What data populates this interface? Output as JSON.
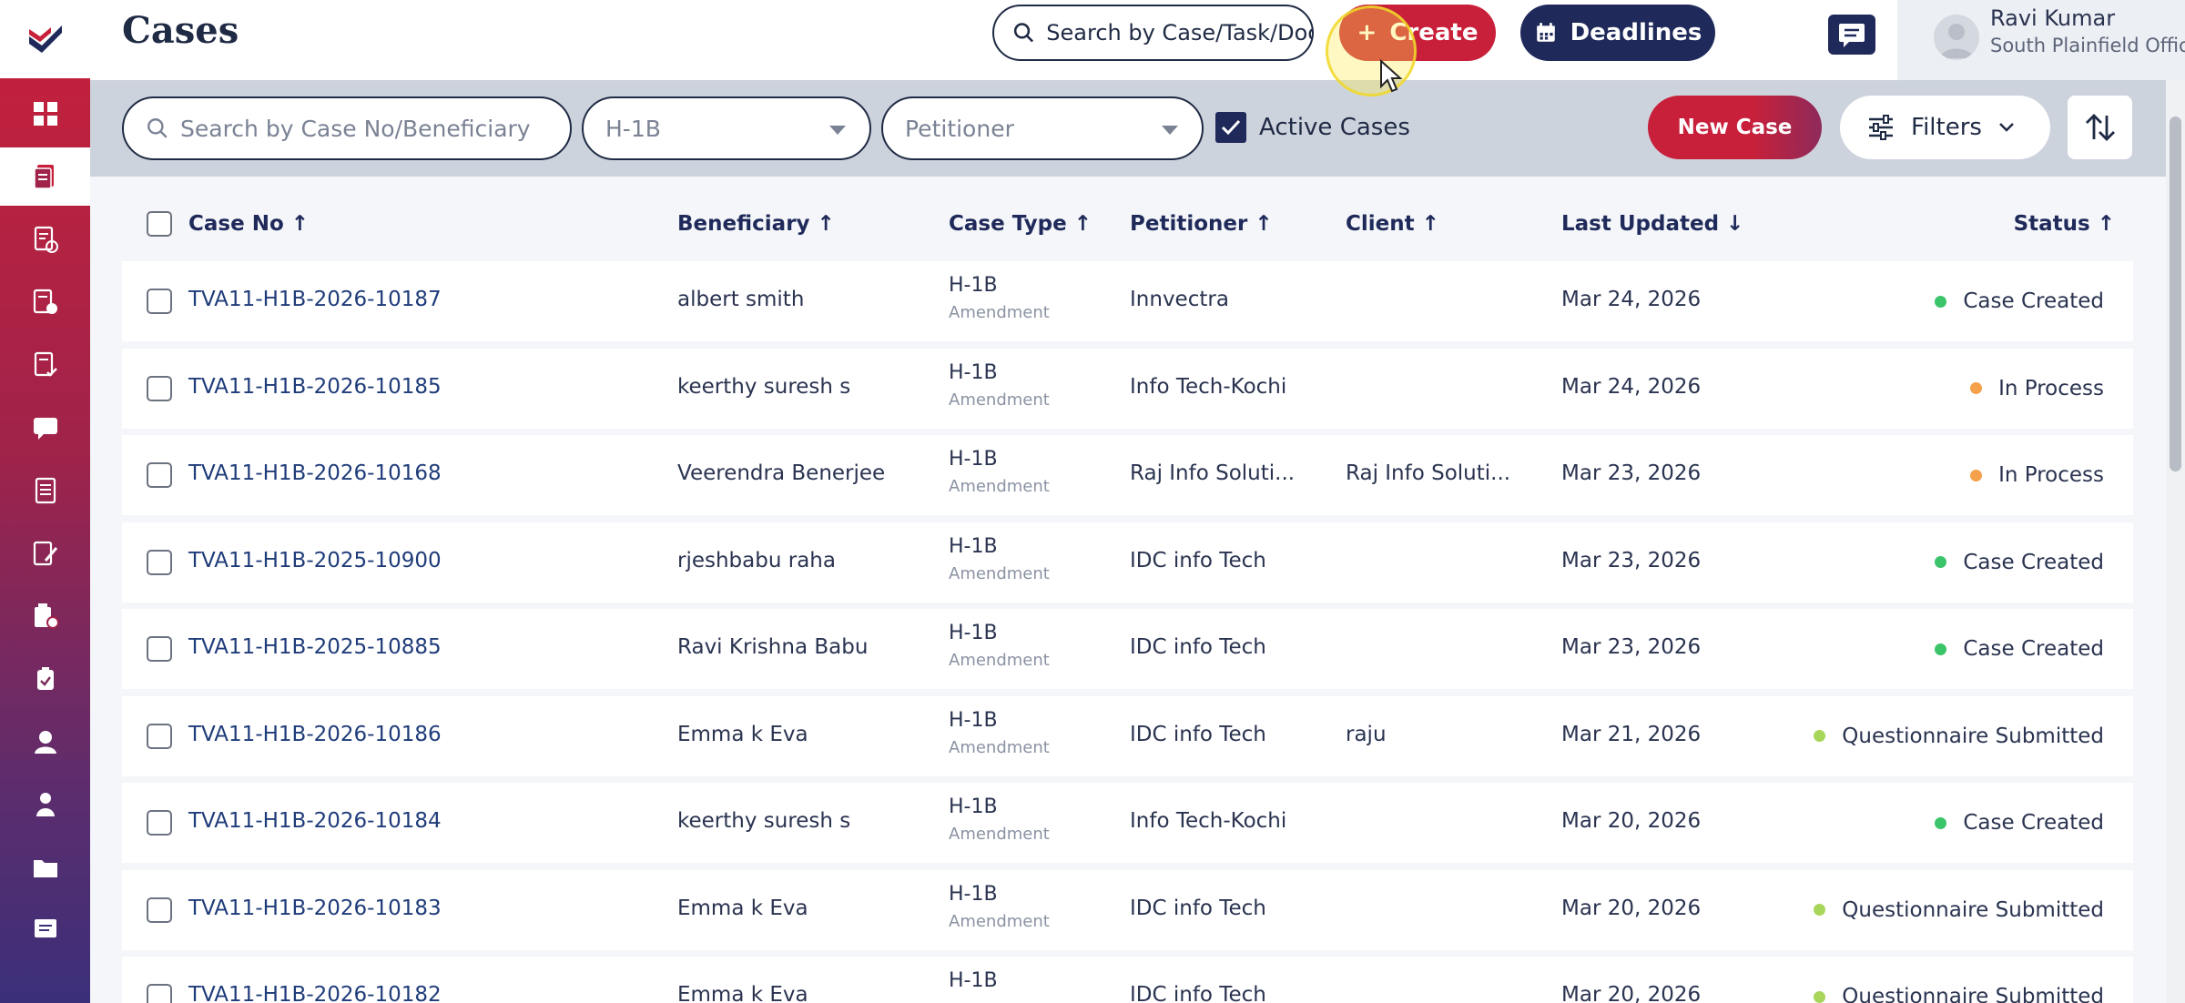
{
  "header": {
    "title": "Cases",
    "global_search_placeholder": "Search by Case/Task/Docu",
    "create_label": "Create",
    "deadlines_label": "Deadlines",
    "user": {
      "name": "Ravi Kumar",
      "office": "South Plainfield Office"
    }
  },
  "toolbar": {
    "search_placeholder": "Search by Case No/Beneficiary",
    "case_type_value": "H-1B",
    "petitioner_placeholder": "Petitioner",
    "active_cases_label": "Active Cases",
    "active_cases_checked": true,
    "new_case_label": "New Case",
    "filters_label": "Filters"
  },
  "table": {
    "columns": {
      "case_no": "Case No ↑",
      "beneficiary": "Beneficiary ↑",
      "case_type": "Case Type ↑",
      "petitioner": "Petitioner ↑",
      "client": "Client ↑",
      "last_updated": "Last Updated ↓",
      "status": "Status ↑"
    },
    "rows": [
      {
        "case_no": "TVA11-H1B-2026-10187",
        "beneficiary": "albert smith",
        "type": "H-1B",
        "subtype": "Amendment",
        "petitioner": "Innvectra",
        "client": "",
        "updated": "Mar 24, 2026",
        "status": "Case Created",
        "status_color": "#3bc46a"
      },
      {
        "case_no": "TVA11-H1B-2026-10185",
        "beneficiary": "keerthy suresh s",
        "type": "H-1B",
        "subtype": "Amendment",
        "petitioner": "Info Tech-Kochi",
        "client": "",
        "updated": "Mar 24, 2026",
        "status": "In Process",
        "status_color": "#f5a04a"
      },
      {
        "case_no": "TVA11-H1B-2026-10168",
        "beneficiary": "Veerendra Benerjee",
        "type": "H-1B",
        "subtype": "Amendment",
        "petitioner": "Raj Info Soluti...",
        "client": "Raj Info Soluti...",
        "updated": "Mar 23, 2026",
        "status": "In Process",
        "status_color": "#f5a04a"
      },
      {
        "case_no": "TVA11-H1B-2025-10900",
        "beneficiary": "rjeshbabu raha",
        "type": "H-1B",
        "subtype": "Amendment",
        "petitioner": "IDC info Tech",
        "client": "",
        "updated": "Mar 23, 2026",
        "status": "Case Created",
        "status_color": "#3bc46a"
      },
      {
        "case_no": "TVA11-H1B-2025-10885",
        "beneficiary": "Ravi Krishna Babu",
        "type": "H-1B",
        "subtype": "Amendment",
        "petitioner": "IDC info Tech",
        "client": "",
        "updated": "Mar 23, 2026",
        "status": "Case Created",
        "status_color": "#3bc46a"
      },
      {
        "case_no": "TVA11-H1B-2026-10186",
        "beneficiary": "Emma k Eva",
        "type": "H-1B",
        "subtype": "Amendment",
        "petitioner": "IDC info Tech",
        "client": "raju",
        "updated": "Mar 21, 2026",
        "status": "Questionnaire Submitted",
        "status_color": "#a8d65a"
      },
      {
        "case_no": "TVA11-H1B-2026-10184",
        "beneficiary": "keerthy suresh s",
        "type": "H-1B",
        "subtype": "Amendment",
        "petitioner": "Info Tech-Kochi",
        "client": "",
        "updated": "Mar 20, 2026",
        "status": "Case Created",
        "status_color": "#3bc46a"
      },
      {
        "case_no": "TVA11-H1B-2026-10183",
        "beneficiary": "Emma k Eva",
        "type": "H-1B",
        "subtype": "Amendment",
        "petitioner": "IDC info Tech",
        "client": "",
        "updated": "Mar 20, 2026",
        "status": "Questionnaire Submitted",
        "status_color": "#a8d65a"
      },
      {
        "case_no": "TVA11-H1B-2026-10182",
        "beneficiary": "Emma k Eva",
        "type": "H-1B",
        "subtype": "",
        "petitioner": "IDC info Tech",
        "client": "",
        "updated": "Mar 20, 2026",
        "status": "Questionnaire Submitted",
        "status_color": "#a8d65a"
      }
    ]
  },
  "sidebar": {
    "items": [
      {
        "icon": "dashboard-icon"
      },
      {
        "icon": "cases-icon",
        "active": true
      },
      {
        "icon": "documents-check-icon"
      },
      {
        "icon": "billing-icon"
      },
      {
        "icon": "forms-check-icon"
      },
      {
        "icon": "messages-icon"
      },
      {
        "icon": "reports-icon"
      },
      {
        "icon": "notes-edit-icon"
      },
      {
        "icon": "tasks-icon"
      },
      {
        "icon": "clipboard-icon"
      },
      {
        "icon": "user-icon"
      },
      {
        "icon": "team-icon"
      },
      {
        "icon": "folder-icon"
      },
      {
        "icon": "chat-icon"
      }
    ]
  },
  "colors": {
    "brand_red": "#c8203a",
    "navy": "#1f2a5a",
    "toolbar_bg": "#cdd3dd"
  }
}
